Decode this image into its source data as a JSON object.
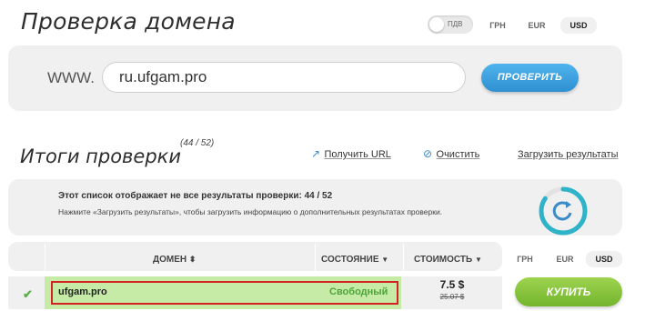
{
  "header": {
    "title": "Проверка домена"
  },
  "vat": {
    "label": "ПДВ",
    "enabled": false
  },
  "currencies_top": [
    "ГРН",
    "EUR",
    "USD"
  ],
  "selected_currency": "USD",
  "search": {
    "prefix": "WWW.",
    "value": "ru.ufgam.pro",
    "button": "ПРОВЕРИТЬ"
  },
  "results": {
    "title": "Итоги проверки",
    "count": "(44 / 52)",
    "links": {
      "get_url": "Получить URL",
      "clear": "Очистить",
      "load": "Загрузить результаты"
    },
    "notice_line1": "Этот список отображает не все результаты проверки: 44 / 52",
    "notice_line2": "Нажмите «Загрузить результаты», чтобы загрузить информацию о дополнительных результатах проверки.",
    "progress_fraction": 0.846
  },
  "table": {
    "headers": {
      "domain": "ДОМЕН",
      "status": "СОСТОЯНИЕ",
      "cost": "СТОИМОСТЬ"
    },
    "currencies": [
      "ГРН",
      "EUR",
      "USD"
    ],
    "rows": [
      {
        "domain": "ufgam.pro",
        "status": "Свободный",
        "price": "7.5 $",
        "old_price": "25.07 $",
        "button": "КУПИТЬ"
      }
    ]
  },
  "colors": {
    "accent_blue": "#2f8fd2",
    "accent_green": "#74b52e",
    "highlight_red": "#d32020",
    "row_green": "#c5eba6"
  }
}
